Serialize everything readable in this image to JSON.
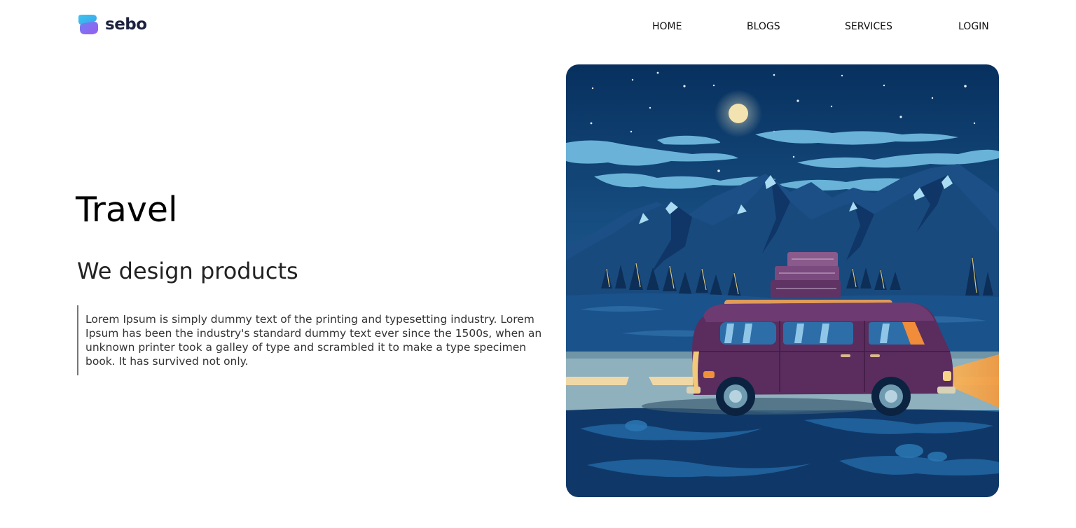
{
  "header": {
    "logo": {
      "text": "sebo",
      "icon": "sebo-logo-mark-icon",
      "colors": {
        "top": "#38b6ec",
        "bottom": "#8e5cf0",
        "text": "#1d2140"
      }
    },
    "nav": [
      {
        "id": "home",
        "label": "HOME"
      },
      {
        "id": "blogs",
        "label": "BLOGS"
      },
      {
        "id": "services",
        "label": "SERVICES"
      },
      {
        "id": "login",
        "label": "LOGIN"
      }
    ]
  },
  "hero": {
    "title": "Travel",
    "subtitle": "We design products",
    "description": "Lorem Ipsum is simply dummy text of the printing and typesetting industry. Lorem Ipsum has been the industry's standard dummy text ever since the 1500s, when an unknown printer took a galley of type and scrambled it to make a type specimen book. It has survived not only.",
    "accent_border_color": "#777777"
  },
  "illustration": {
    "subject": "night-road-trip-van-illustration",
    "colors": {
      "sky": "#0b3a6b",
      "moon": "#f3e3b0",
      "mountains": "#1b4f86",
      "van": "#5a2d5e",
      "road": "#8fb0bd",
      "headlight": "#f0a24a",
      "ground": "#0f3868"
    }
  }
}
